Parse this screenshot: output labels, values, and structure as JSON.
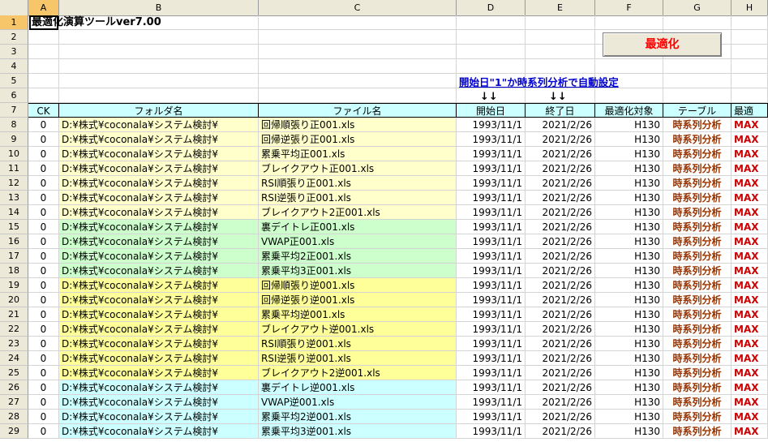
{
  "columns": [
    "A",
    "B",
    "C",
    "D",
    "E",
    "F",
    "G",
    "H"
  ],
  "title": "最適化演算ツールver7.00",
  "optimize_button": "最適化",
  "auto_note": "開始日\"1\"か時系列分析で自動設定",
  "arrows_start": "↓↓",
  "arrows_end": "↓↓",
  "row_numbers": [
    "1",
    "2",
    "3",
    "4",
    "5",
    "6",
    "7",
    "8",
    "9",
    "10",
    "11",
    "12",
    "13",
    "14",
    "15",
    "16",
    "17",
    "18",
    "19",
    "20",
    "21",
    "22",
    "23",
    "24",
    "25",
    "26",
    "27",
    "28",
    "29"
  ],
  "headers": {
    "ck": "CK",
    "folder": "フォルダ名",
    "file": "ファイル名",
    "start": "開始日",
    "end": "終了日",
    "target": "最適化対象",
    "table": "テーブル",
    "opt": "最適"
  },
  "rows": [
    {
      "ck": "0",
      "folder": "D:¥株式¥coconala¥システム検討¥",
      "file": "回帰順張り正001.xls",
      "start": "1993/11/1",
      "end": "2021/2/26",
      "target": "H130",
      "table": "時系列分析",
      "opt": "MAX"
    },
    {
      "ck": "0",
      "folder": "D:¥株式¥coconala¥システム検討¥",
      "file": "回帰逆張り正001.xls",
      "start": "1993/11/1",
      "end": "2021/2/26",
      "target": "H130",
      "table": "時系列分析",
      "opt": "MAX"
    },
    {
      "ck": "0",
      "folder": "D:¥株式¥coconala¥システム検討¥",
      "file": "累乗平均正001.xls",
      "start": "1993/11/1",
      "end": "2021/2/26",
      "target": "H130",
      "table": "時系列分析",
      "opt": "MAX"
    },
    {
      "ck": "0",
      "folder": "D:¥株式¥coconala¥システム検討¥",
      "file": "ブレイクアウト正001.xls",
      "start": "1993/11/1",
      "end": "2021/2/26",
      "target": "H130",
      "table": "時系列分析",
      "opt": "MAX"
    },
    {
      "ck": "0",
      "folder": "D:¥株式¥coconala¥システム検討¥",
      "file": "RSI順張り正001.xls",
      "start": "1993/11/1",
      "end": "2021/2/26",
      "target": "H130",
      "table": "時系列分析",
      "opt": "MAX"
    },
    {
      "ck": "0",
      "folder": "D:¥株式¥coconala¥システム検討¥",
      "file": "RSI逆張り正001.xls",
      "start": "1993/11/1",
      "end": "2021/2/26",
      "target": "H130",
      "table": "時系列分析",
      "opt": "MAX"
    },
    {
      "ck": "0",
      "folder": "D:¥株式¥coconala¥システム検討¥",
      "file": "ブレイクアウト2正001.xls",
      "start": "1993/11/1",
      "end": "2021/2/26",
      "target": "H130",
      "table": "時系列分析",
      "opt": "MAX"
    },
    {
      "ck": "0",
      "folder": "D:¥株式¥coconala¥システム検討¥",
      "file": "裏デイトレ正001.xls",
      "start": "1993/11/1",
      "end": "2021/2/26",
      "target": "H130",
      "table": "時系列分析",
      "opt": "MAX"
    },
    {
      "ck": "0",
      "folder": "D:¥株式¥coconala¥システム検討¥",
      "file": "VWAP正001.xls",
      "start": "1993/11/1",
      "end": "2021/2/26",
      "target": "H130",
      "table": "時系列分析",
      "opt": "MAX"
    },
    {
      "ck": "0",
      "folder": "D:¥株式¥coconala¥システム検討¥",
      "file": "累乗平均2正001.xls",
      "start": "1993/11/1",
      "end": "2021/2/26",
      "target": "H130",
      "table": "時系列分析",
      "opt": "MAX"
    },
    {
      "ck": "0",
      "folder": "D:¥株式¥coconala¥システム検討¥",
      "file": "累乗平均3正001.xls",
      "start": "1993/11/1",
      "end": "2021/2/26",
      "target": "H130",
      "table": "時系列分析",
      "opt": "MAX"
    },
    {
      "ck": "0",
      "folder": "D:¥株式¥coconala¥システム検討¥",
      "file": "回帰順張り逆001.xls",
      "start": "1993/11/1",
      "end": "2021/2/26",
      "target": "H130",
      "table": "時系列分析",
      "opt": "MAX"
    },
    {
      "ck": "0",
      "folder": "D:¥株式¥coconala¥システム検討¥",
      "file": "回帰逆張り逆001.xls",
      "start": "1993/11/1",
      "end": "2021/2/26",
      "target": "H130",
      "table": "時系列分析",
      "opt": "MAX"
    },
    {
      "ck": "0",
      "folder": "D:¥株式¥coconala¥システム検討¥",
      "file": "累乗平均逆001.xls",
      "start": "1993/11/1",
      "end": "2021/2/26",
      "target": "H130",
      "table": "時系列分析",
      "opt": "MAX"
    },
    {
      "ck": "0",
      "folder": "D:¥株式¥coconala¥システム検討¥",
      "file": "ブレイクアウト逆001.xls",
      "start": "1993/11/1",
      "end": "2021/2/26",
      "target": "H130",
      "table": "時系列分析",
      "opt": "MAX"
    },
    {
      "ck": "0",
      "folder": "D:¥株式¥coconala¥システム検討¥",
      "file": "RSI順張り逆001.xls",
      "start": "1993/11/1",
      "end": "2021/2/26",
      "target": "H130",
      "table": "時系列分析",
      "opt": "MAX"
    },
    {
      "ck": "0",
      "folder": "D:¥株式¥coconala¥システム検討¥",
      "file": "RSI逆張り逆001.xls",
      "start": "1993/11/1",
      "end": "2021/2/26",
      "target": "H130",
      "table": "時系列分析",
      "opt": "MAX"
    },
    {
      "ck": "0",
      "folder": "D:¥株式¥coconala¥システム検討¥",
      "file": "ブレイクアウト2逆001.xls",
      "start": "1993/11/1",
      "end": "2021/2/26",
      "target": "H130",
      "table": "時系列分析",
      "opt": "MAX"
    },
    {
      "ck": "0",
      "folder": "D:¥株式¥coconala¥システム検討¥",
      "file": "裏デイトレ逆001.xls",
      "start": "1993/11/1",
      "end": "2021/2/26",
      "target": "H130",
      "table": "時系列分析",
      "opt": "MAX"
    },
    {
      "ck": "0",
      "folder": "D:¥株式¥coconala¥システム検討¥",
      "file": "VWAP逆001.xls",
      "start": "1993/11/1",
      "end": "2021/2/26",
      "target": "H130",
      "table": "時系列分析",
      "opt": "MAX"
    },
    {
      "ck": "0",
      "folder": "D:¥株式¥coconala¥システム検討¥",
      "file": "累乗平均2逆001.xls",
      "start": "1993/11/1",
      "end": "2021/2/26",
      "target": "H130",
      "table": "時系列分析",
      "opt": "MAX"
    },
    {
      "ck": "0",
      "folder": "D:¥株式¥coconala¥システム検討¥",
      "file": "累乗平均3逆001.xls",
      "start": "1993/11/1",
      "end": "2021/2/26",
      "target": "H130",
      "table": "時系列分析",
      "opt": "MAX"
    }
  ],
  "colors": {
    "header_bg": "#ccffff",
    "group1": "#ffffcc",
    "group2": "#ccffcc",
    "group3": "#ffff99",
    "group4": "#ccffff",
    "accent_red": "#cc0000",
    "accent_brown": "#993300",
    "link_blue": "#0000cc"
  }
}
